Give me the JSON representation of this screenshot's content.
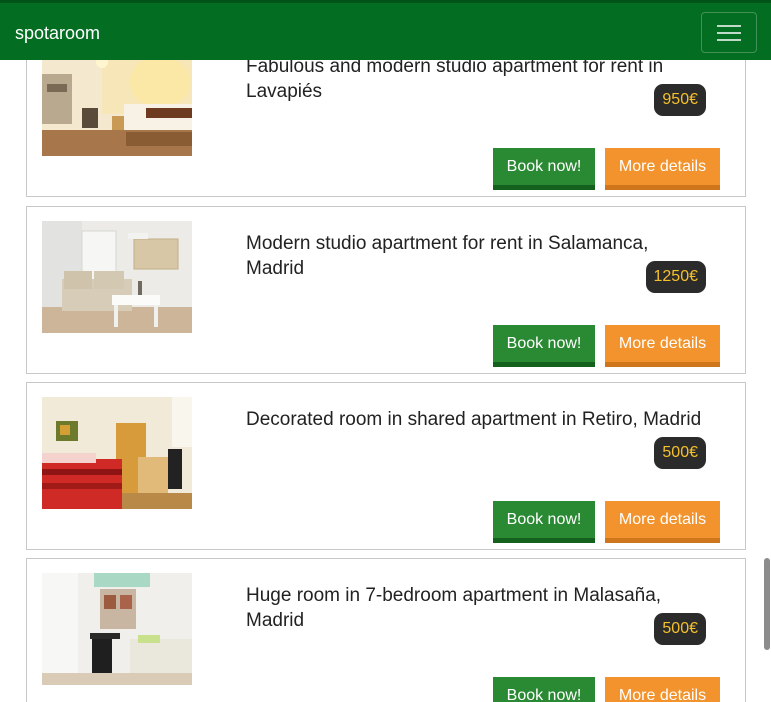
{
  "navbar": {
    "brand": "spotaroom",
    "menu_icon": "hamburger-icon"
  },
  "listings": [
    {
      "title": "Fabulous and modern studio apartment for rent in Lavapiés",
      "price": "950€",
      "book_label": "Book now!",
      "details_label": "More details",
      "photo": "bedroom-with-kitchenette"
    },
    {
      "title": "Modern studio apartment for rent in Salamanca, Madrid",
      "price": "1250€",
      "book_label": "Book now!",
      "details_label": "More details",
      "photo": "living-room-sofa"
    },
    {
      "title": "Decorated room in shared apartment in Retiro, Madrid",
      "price": "500€",
      "book_label": "Book now!",
      "details_label": "More details",
      "photo": "bedroom-red-bedspread"
    },
    {
      "title": "Huge room in 7-bedroom apartment in Malasaña, Madrid",
      "price": "500€",
      "book_label": "Book now!",
      "details_label": "More details",
      "photo": "bedroom-with-desk"
    }
  ],
  "colors": {
    "navbar": "#036d22",
    "book_button": "#2a8a34",
    "details_button": "#f2932d",
    "price_badge_bg": "#2b2b2b",
    "price_badge_text": "#f5c02c"
  }
}
